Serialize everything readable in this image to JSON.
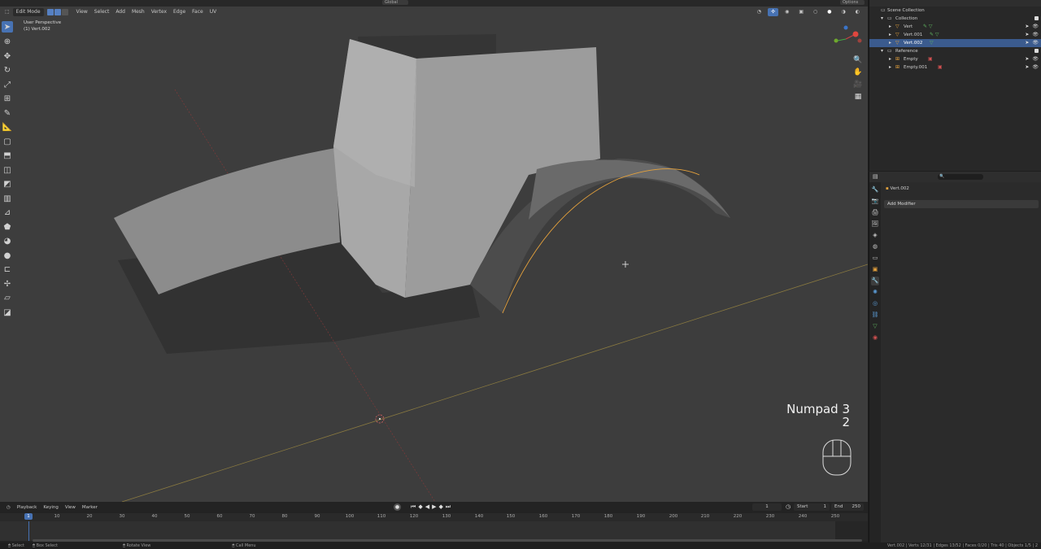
{
  "viewport": {
    "mode": "Edit Mode",
    "menus": [
      "View",
      "Select",
      "Add",
      "Mesh",
      "Vertex",
      "Edge",
      "Face",
      "UV"
    ],
    "orientation": "Global",
    "options": "Options",
    "info_line1": "User Perspective",
    "info_line2": "(1) Vert.002",
    "key_display": {
      "line1": "Numpad 3",
      "line2": "2"
    },
    "tools": [
      "cursor-select",
      "cursor",
      "move",
      "rotate",
      "scale",
      "transform",
      "annotate",
      "measure",
      "add-cube",
      "extrude",
      "inset",
      "bevel",
      "loop-cut",
      "knife",
      "poly-build",
      "spin",
      "smooth",
      "edge-slide",
      "shrink-fatten",
      "shear",
      "rip"
    ],
    "accent": "#4772b3"
  },
  "timeline": {
    "menus": [
      "Playback",
      "Keying",
      "View",
      "Marker"
    ],
    "current_frame": "1",
    "start_label": "Start",
    "start_value": "1",
    "end_label": "End",
    "end_value": "250",
    "ticks": [
      "1",
      "10",
      "20",
      "30",
      "40",
      "50",
      "60",
      "70",
      "80",
      "90",
      "100",
      "110",
      "120",
      "130",
      "140",
      "150",
      "160",
      "170",
      "180",
      "190",
      "200",
      "210",
      "220",
      "230",
      "240",
      "250"
    ]
  },
  "statusbar": {
    "items": [
      "Select",
      "Box Select",
      "Rotate View",
      "Call Menu"
    ],
    "stats": "Vert.002 | Verts 12/31 | Edges 13/52 | Faces 0/20 | Tris 40 | Objects 1/5 | 2"
  },
  "outliner": {
    "rows": [
      {
        "label": "Scene Collection",
        "indent": 0
      },
      {
        "label": "Collection",
        "indent": 1
      },
      {
        "label": "Vert",
        "indent": 2
      },
      {
        "label": "Vert.001",
        "indent": 2
      },
      {
        "label": "Vert.002",
        "indent": 2,
        "selected": true
      },
      {
        "label": "Reference",
        "indent": 1
      },
      {
        "label": "Empty",
        "indent": 2
      },
      {
        "label": "Empty.001",
        "indent": 2
      }
    ]
  },
  "properties": {
    "object_name": "Vert.002",
    "add_modifier": "Add Modifier"
  }
}
